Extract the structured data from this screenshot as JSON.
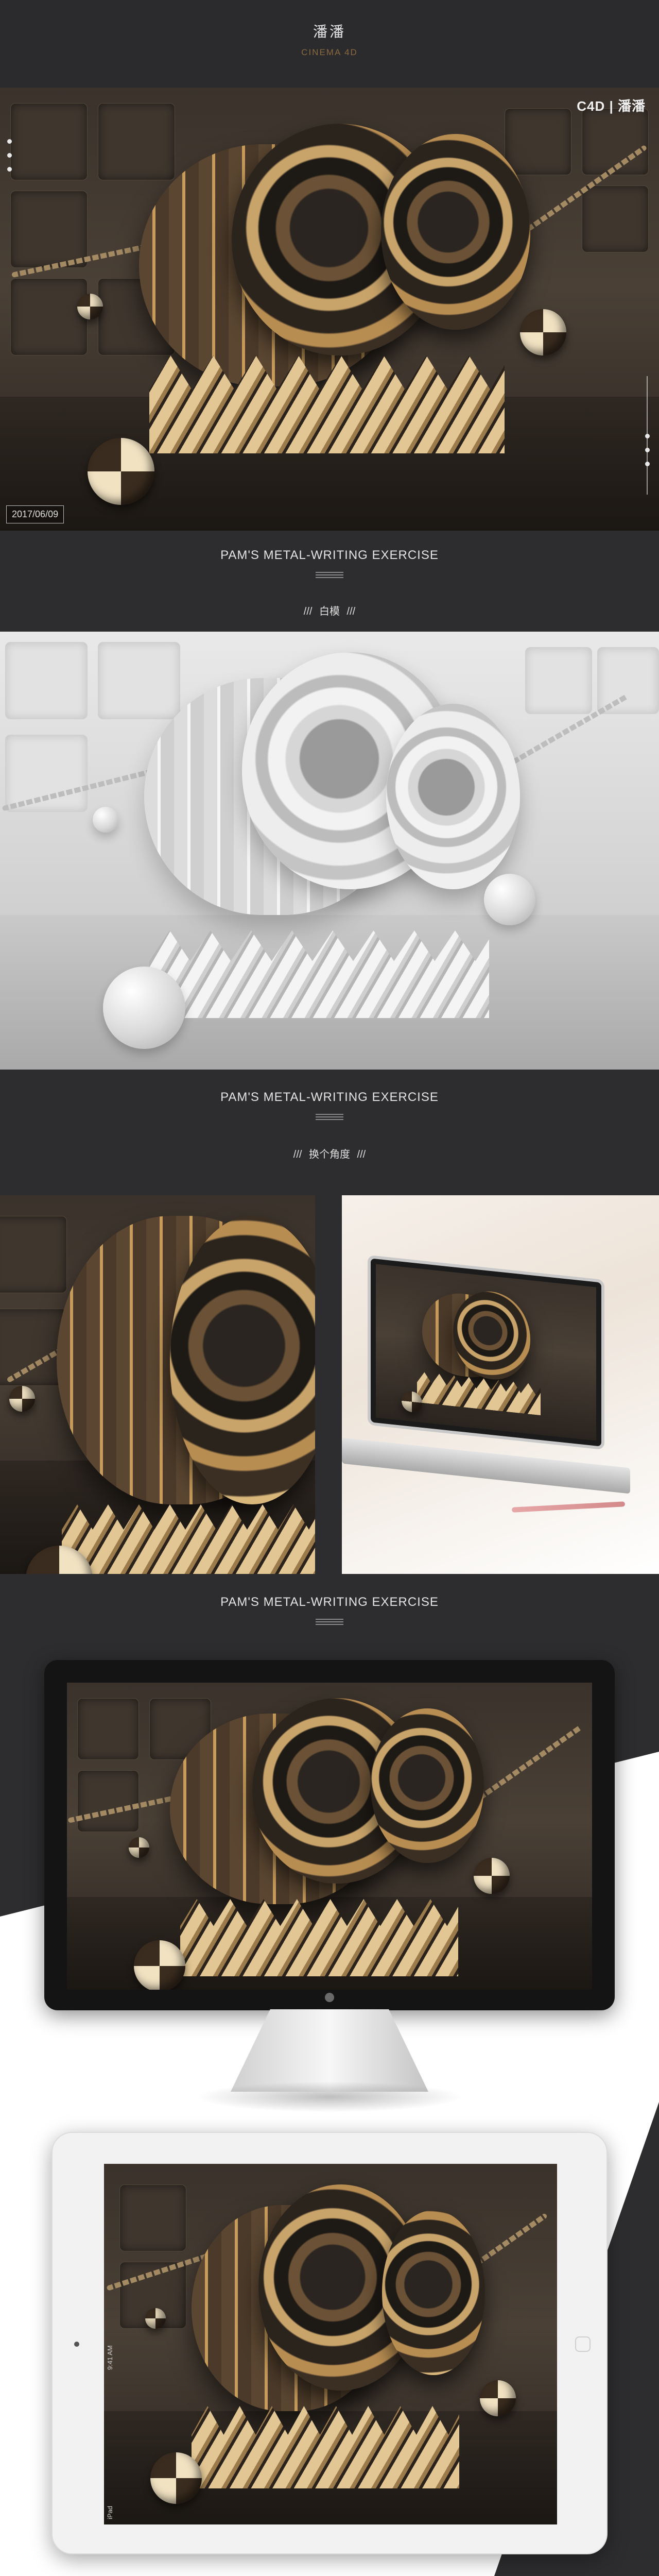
{
  "header": {
    "title": "潘潘",
    "subtitle": "CINEMA 4D"
  },
  "hero": {
    "brand": "C4D | 潘潘",
    "date": "2017/06/09"
  },
  "sections": [
    {
      "title": "PAM'S METAL-WRITING EXERCISE",
      "subtitle": "///   白模   ///"
    },
    {
      "title": "PAM'S METAL-WRITING EXERCISE",
      "subtitle": "///   换个角度   ///"
    },
    {
      "title": "PAM'S METAL-WRITING EXERCISE"
    }
  ],
  "tablet": {
    "status_time": "9:41 AM",
    "status_carrier": "iPad"
  },
  "colors": {
    "background": "#2d2d2f",
    "accent_gold": "#8a6a3e",
    "text": "#e4e4e4"
  }
}
